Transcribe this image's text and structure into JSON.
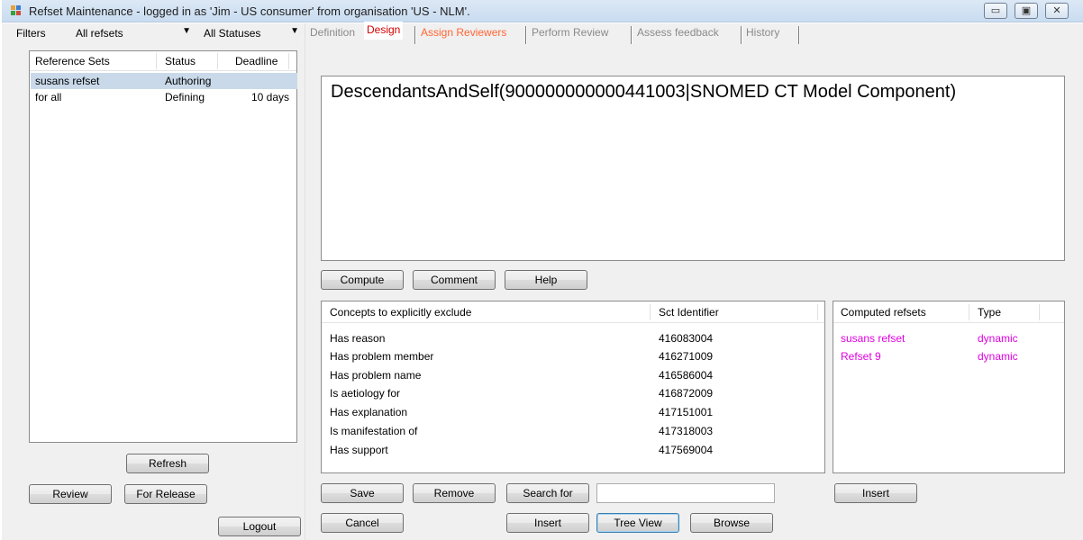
{
  "window": {
    "title": "Refset Maintenance - logged in as 'Jim - US consumer' from organisation 'US - NLM'.",
    "minimize_label": "▭",
    "maximize_label": "▣",
    "close_label": "✕"
  },
  "filters": {
    "label": "Filters",
    "refset_filter": "All refsets",
    "status_filter": "All Statuses"
  },
  "refset_list": {
    "columns": [
      "Reference Sets",
      "Status",
      "Deadline"
    ],
    "rows": [
      {
        "name": "susans refset",
        "status": "Authoring",
        "deadline": ""
      },
      {
        "name": "for all",
        "status": "Defining",
        "deadline": "10 days"
      }
    ]
  },
  "left_buttons": {
    "refresh": "Refresh",
    "review": "Review",
    "for_release": "For Release",
    "logout": "Logout"
  },
  "tabs": [
    {
      "label": "Definition"
    },
    {
      "label": "Design"
    },
    {
      "label": "Assign Reviewers"
    },
    {
      "label": "Perform Review"
    },
    {
      "label": "Assess feedback"
    },
    {
      "label": "History"
    }
  ],
  "definition": {
    "expression": "DescendantsAndSelf(900000000000441003|SNOMED CT Model Component)"
  },
  "action_buttons": {
    "compute": "Compute",
    "comment": "Comment",
    "help": "Help"
  },
  "exclusions": {
    "columns": [
      "Concepts to explicitly exclude",
      "Sct Identifier"
    ],
    "rows": [
      {
        "concept": "Has reason",
        "id": "416083004"
      },
      {
        "concept": "Has problem member",
        "id": "416271009"
      },
      {
        "concept": "Has problem name",
        "id": "416586004"
      },
      {
        "concept": "Is aetiology for",
        "id": "416872009"
      },
      {
        "concept": "Has explanation",
        "id": "417151001"
      },
      {
        "concept": "Is manifestation of",
        "id": "417318003"
      },
      {
        "concept": "Has support",
        "id": "417569004"
      }
    ]
  },
  "computed_refsets": {
    "columns": [
      "Computed refsets",
      "Type"
    ],
    "rows": [
      {
        "name": "susans refset",
        "type": "dynamic"
      },
      {
        "name": "Refset 9",
        "type": "dynamic"
      }
    ],
    "row_color": "#e000e0"
  },
  "bottom_buttons": {
    "save": "Save",
    "remove": "Remove",
    "search_for": "Search for",
    "search_value": "",
    "insert_right": "Insert",
    "cancel": "Cancel",
    "insert": "Insert",
    "tree_view": "Tree View",
    "browse": "Browse"
  }
}
